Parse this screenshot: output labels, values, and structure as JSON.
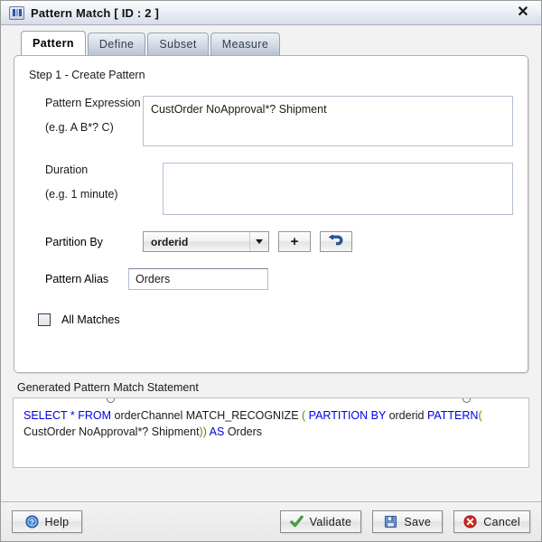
{
  "window": {
    "title": "Pattern Match [ ID : 2 ]",
    "icon": "pattern-match-icon",
    "close_label": "✕"
  },
  "tabs": [
    {
      "label": "Pattern",
      "active": true
    },
    {
      "label": "Define",
      "active": false
    },
    {
      "label": "Subset",
      "active": false
    },
    {
      "label": "Measure",
      "active": false
    }
  ],
  "pattern_tab": {
    "step_title": "Step 1 - Create Pattern",
    "pattern_expression": {
      "label": "Pattern Expression",
      "hint": "(e.g. A B*? C)",
      "value": "CustOrder NoApproval*? Shipment",
      "placeholder": ""
    },
    "duration": {
      "label": "Duration",
      "hint": "(e.g. 1 minute)",
      "value": "",
      "placeholder": ""
    },
    "partition_by": {
      "label": "Partition By",
      "selected": "orderid",
      "options": [
        "orderid"
      ],
      "add_label": "+",
      "undo_label": ""
    },
    "pattern_alias": {
      "label": "Pattern Alias",
      "value": "Orders",
      "placeholder": ""
    },
    "all_matches": {
      "label": "All Matches",
      "checked": false
    }
  },
  "generated": {
    "label": "Generated Pattern Match Statement",
    "tokens": [
      {
        "t": "SELECT",
        "c": "kw"
      },
      {
        "t": " ",
        "c": "plain"
      },
      {
        "t": "*",
        "c": "kw"
      },
      {
        "t": " ",
        "c": "plain"
      },
      {
        "t": "FROM",
        "c": "kw"
      },
      {
        "t": " orderChannel  MATCH_RECOGNIZE ",
        "c": "plain"
      },
      {
        "t": "(",
        "c": "paren"
      },
      {
        "t": " ",
        "c": "plain"
      },
      {
        "t": "PARTITION BY",
        "c": "kw"
      },
      {
        "t": " orderid ",
        "c": "plain"
      },
      {
        "t": "PATTERN",
        "c": "kw"
      },
      {
        "t": "(",
        "c": "paren"
      },
      {
        "t": " CustOrder NoApproval*? Shipment",
        "c": "plain"
      },
      {
        "t": "))",
        "c": "paren"
      },
      {
        "t": " ",
        "c": "plain"
      },
      {
        "t": "AS",
        "c": "kw"
      },
      {
        "t": " Orders",
        "c": "plain"
      }
    ],
    "plain_text": "SELECT * FROM orderChannel  MATCH_RECOGNIZE ( PARTITION BY orderid PATTERN( CustOrder NoApproval*? Shipment)) AS Orders"
  },
  "footer": {
    "help": "Help",
    "validate": "Validate",
    "save": "Save",
    "cancel": "Cancel"
  },
  "colors": {
    "keyword": "#0000e6",
    "paren": "#7a7a00",
    "titlebar": "#d7dce8",
    "accent_blue": "#2a55a8"
  }
}
